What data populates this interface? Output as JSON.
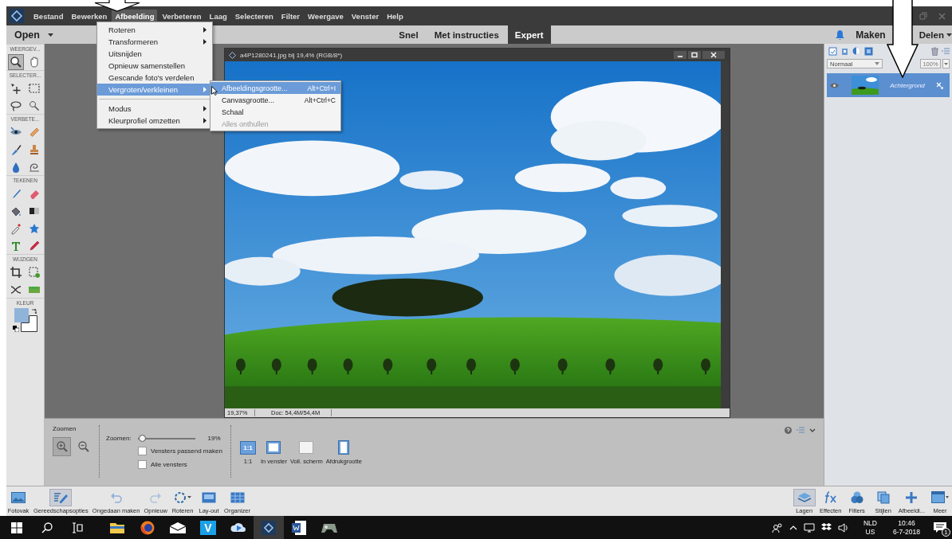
{
  "menubar": {
    "items": [
      {
        "label": "Bestand",
        "selected": false
      },
      {
        "label": "Bewerken",
        "selected": false
      },
      {
        "label": "Afbeelding",
        "selected": true
      },
      {
        "label": "Verbeteren",
        "selected": false
      },
      {
        "label": "Laag",
        "selected": false
      },
      {
        "label": "Selecteren",
        "selected": false
      },
      {
        "label": "Filter",
        "selected": false
      },
      {
        "label": "Weergave",
        "selected": false
      },
      {
        "label": "Venster",
        "selected": false
      },
      {
        "label": "Help",
        "selected": false
      }
    ]
  },
  "modebar": {
    "open": "Open",
    "modes": [
      {
        "label": "Snel",
        "selected": false
      },
      {
        "label": "Met instructies",
        "selected": false
      },
      {
        "label": "Expert",
        "selected": true
      }
    ],
    "create": "Maken",
    "share": "Delen"
  },
  "menu": {
    "items": [
      {
        "kind": "item",
        "label": "Roteren",
        "submenu": true,
        "selected": false
      },
      {
        "kind": "item",
        "label": "Transformeren",
        "submenu": true,
        "selected": false
      },
      {
        "kind": "item",
        "label": "Uitsnijden",
        "submenu": false,
        "selected": false
      },
      {
        "kind": "item",
        "label": "Opnieuw samenstellen",
        "submenu": false,
        "selected": false
      },
      {
        "kind": "item",
        "label": "Gescande foto's verdelen",
        "submenu": false,
        "selected": false
      },
      {
        "kind": "item",
        "label": "Vergroten/verkleinen",
        "submenu": true,
        "selected": true
      },
      {
        "kind": "separator"
      },
      {
        "kind": "item",
        "label": "Modus",
        "submenu": true,
        "selected": false
      },
      {
        "kind": "item",
        "label": "Kleurprofiel omzetten",
        "submenu": true,
        "selected": false
      }
    ]
  },
  "submenu": {
    "items": [
      {
        "label": "Afbeeldingsgrootte...",
        "shortcut": "Alt+Ctrl+I",
        "selected": true,
        "disabled": false
      },
      {
        "label": "Canvasgrootte...",
        "shortcut": "Alt+Ctrl+C",
        "selected": false,
        "disabled": false
      },
      {
        "label": "Schaal",
        "selected": false,
        "disabled": false
      },
      {
        "label": "Alles onthullen",
        "selected": false,
        "disabled": true
      }
    ]
  },
  "toolbox": {
    "groups": [
      {
        "label": "WEERGEV...",
        "tools": [
          {
            "selected": true
          },
          {
            "selected": false
          }
        ]
      },
      {
        "label": "SELECTER...",
        "tools": [
          {
            "selected": false
          },
          {
            "selected": false
          },
          {
            "selected": false
          },
          {
            "selected": false
          }
        ]
      },
      {
        "label": "VERBETE...",
        "tools": [
          {
            "selected": false
          },
          {
            "selected": false
          },
          {
            "selected": false
          },
          {
            "selected": false
          },
          {
            "selected": false
          },
          {
            "selected": false
          }
        ]
      },
      {
        "label": "TEKENEN",
        "tools": [
          {
            "selected": false
          },
          {
            "selected": false
          },
          {
            "selected": false
          },
          {
            "selected": false
          },
          {
            "selected": false
          },
          {
            "selected": false
          },
          {
            "selected": false
          },
          {
            "selected": false
          }
        ]
      },
      {
        "label": "WIJZIGEN",
        "tools": [
          {
            "selected": false
          },
          {
            "selected": false
          },
          {
            "selected": false
          },
          {
            "selected": false
          }
        ]
      }
    ],
    "color_label": "KLEUR",
    "colors": [
      {
        "kind": "foreground",
        "color": "#8fb4d8"
      },
      {
        "kind": "background",
        "color": "#ffffff"
      }
    ]
  },
  "document": {
    "title": "a4P1280241.jpg bij 19,4% (RGB/8*)",
    "zoom": "19,37%",
    "doc_size": "Doc: 54,4M/54,4M"
  },
  "tool_options": {
    "title": "Zoomen",
    "modes": [
      {
        "selected": true
      },
      {
        "selected": false
      }
    ],
    "zoom_label": "Zoomen:",
    "zoom_slider": {
      "level": 0.03
    },
    "zoom_value": "19%",
    "checkboxes": [
      {
        "label": "Vensters passend maken",
        "checked": false
      },
      {
        "label": "Alle vensters",
        "checked": false
      }
    ],
    "view_buttons": [
      {
        "label": "1:1",
        "icon_text": "1:1"
      },
      {
        "label": "In venster"
      },
      {
        "label": "Voll. scherm"
      },
      {
        "label": "Afdrukgrootte"
      }
    ]
  },
  "layers_panel": {
    "blend_mode": "Normaal",
    "opacity": "100%",
    "layers": [
      {
        "name": "Achtergrond",
        "selected": true,
        "visible": true
      }
    ]
  },
  "bottom_bar": {
    "left": [
      {
        "label": "Fotovak",
        "selected": false
      },
      {
        "label": "Gereedschapsopties",
        "selected": true
      },
      {
        "label": "Ongedaan maken",
        "selected": false
      },
      {
        "label": "Opnieuw",
        "selected": false
      },
      {
        "label": "Roteren",
        "selected": false
      },
      {
        "label": "Lay-out",
        "selected": false
      },
      {
        "label": "Organizer",
        "selected": false
      }
    ],
    "right": [
      {
        "label": "Lagen",
        "selected": true
      },
      {
        "label": "Effecten",
        "selected": false
      },
      {
        "label": "Filters",
        "selected": false
      },
      {
        "label": "Stijlen",
        "selected": false
      },
      {
        "label": "Afbeeldi...",
        "selected": false
      },
      {
        "label": "Meer",
        "selected": false
      }
    ]
  },
  "taskbar": {
    "apps": [
      {
        "active": false
      },
      {
        "active": false
      },
      {
        "active": false
      },
      {
        "active": false,
        "logo_text": "V"
      },
      {
        "active": false
      },
      {
        "active": true
      },
      {
        "active": false
      },
      {
        "active": false
      }
    ],
    "language": "NLD",
    "layout": "US",
    "time": "10:46",
    "date": "6-7-2018",
    "notifications": "1"
  }
}
